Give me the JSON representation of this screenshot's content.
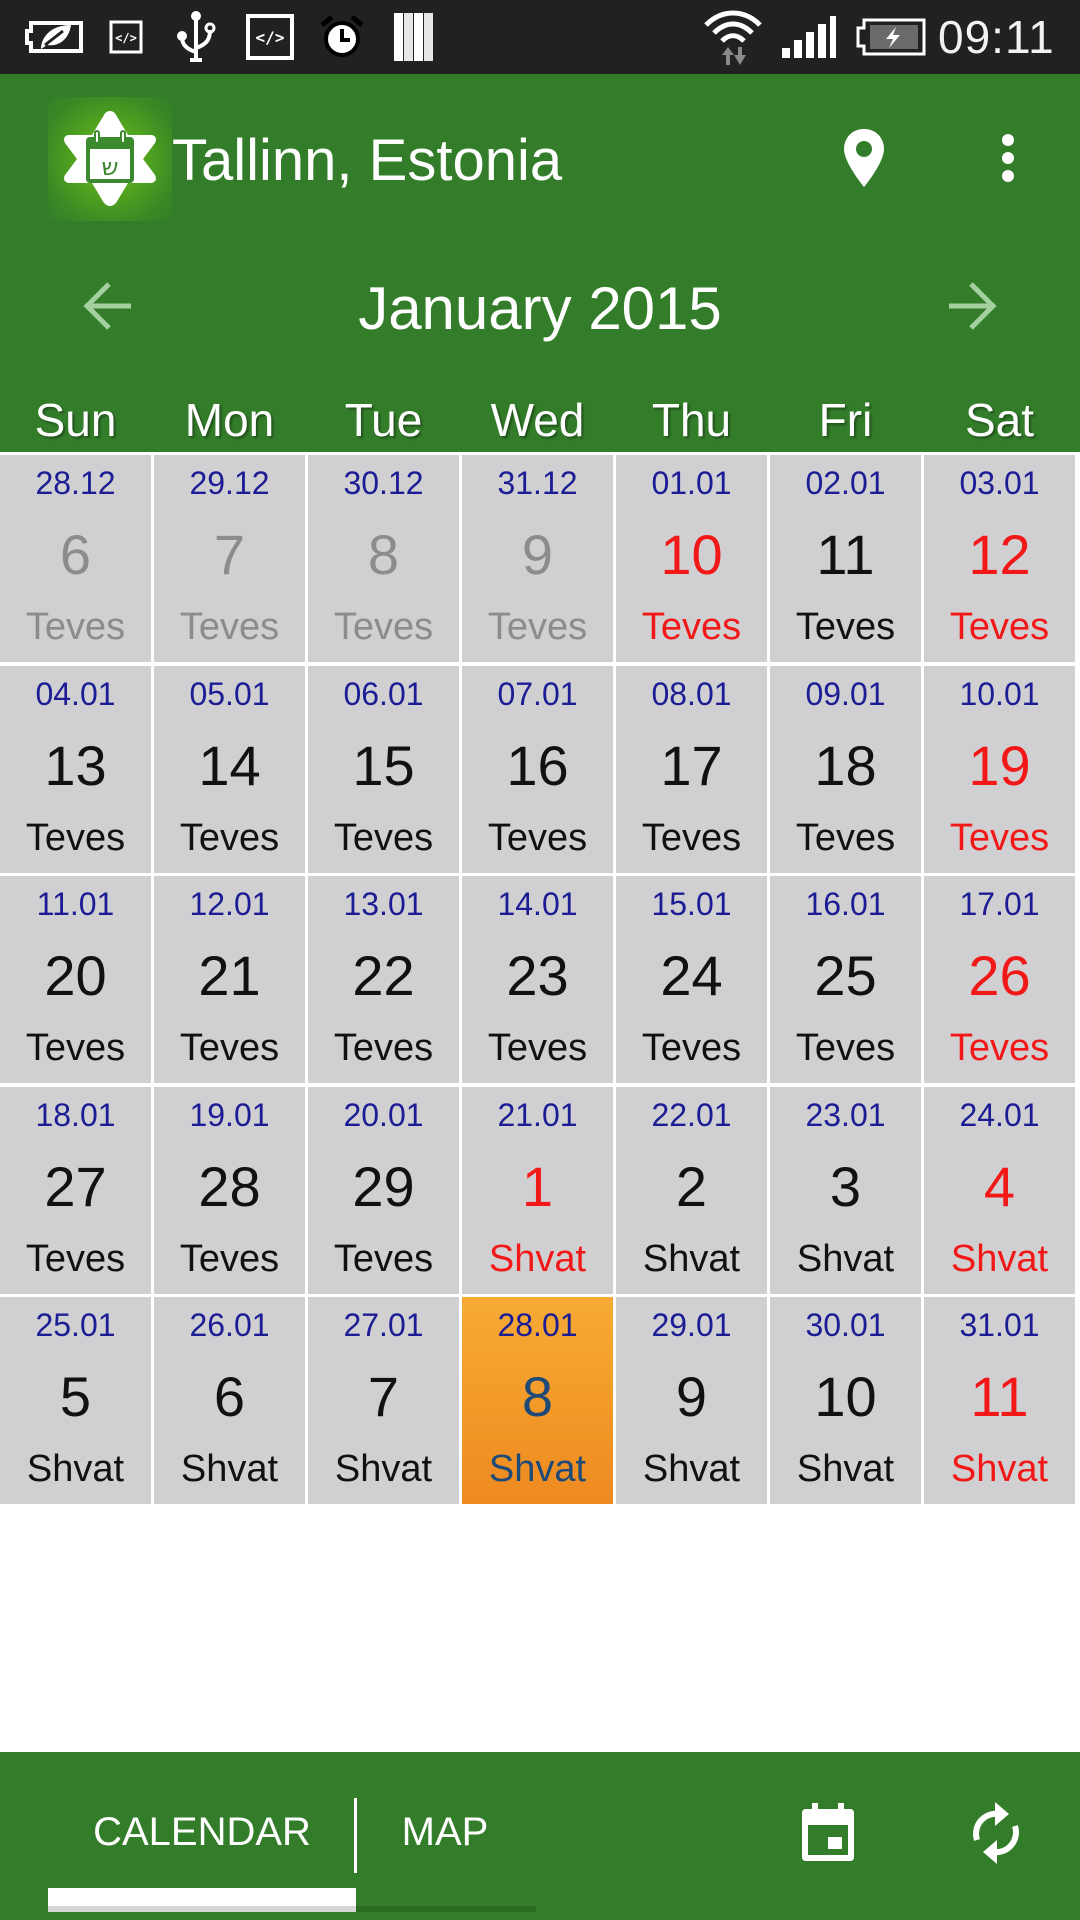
{
  "status_bar": {
    "time": "09:11",
    "left_icons": [
      "battery-saver-icon",
      "developer-code-small-icon",
      "usb-icon",
      "developer-code-icon",
      "alarm-icon",
      "storage-bars-icon"
    ],
    "right_icons": [
      "wifi-data-icon",
      "signal-icon",
      "battery-charging-icon"
    ]
  },
  "app_bar": {
    "logo_glyph": "ש",
    "title": "Tallinn, Estonia",
    "location_icon": "map-pin-icon",
    "menu_icon": "more-vert-icon"
  },
  "calendar": {
    "month_title": "January 2015",
    "prev_label": "previous month",
    "next_label": "next month",
    "weekdays": [
      "Sun",
      "Mon",
      "Tue",
      "Wed",
      "Thu",
      "Fri",
      "Sat"
    ],
    "colors": {
      "gregorian": "#1c1c94",
      "normal": "#111111",
      "other_month": "#8c8c8c",
      "holiday": "#f21818",
      "today_text": "#1f4a78",
      "today_bg": "#f29a2a",
      "cell_bg": "#d0d0d2",
      "brand_green": "#337d2a"
    },
    "weeks": [
      [
        {
          "greg": "28.12",
          "day": "6",
          "month": "Teves",
          "state": "other"
        },
        {
          "greg": "29.12",
          "day": "7",
          "month": "Teves",
          "state": "other"
        },
        {
          "greg": "30.12",
          "day": "8",
          "month": "Teves",
          "state": "other"
        },
        {
          "greg": "31.12",
          "day": "9",
          "month": "Teves",
          "state": "other"
        },
        {
          "greg": "01.01",
          "day": "10",
          "month": "Teves",
          "state": "holiday"
        },
        {
          "greg": "02.01",
          "day": "11",
          "month": "Teves",
          "state": "normal"
        },
        {
          "greg": "03.01",
          "day": "12",
          "month": "Teves",
          "state": "holiday"
        }
      ],
      [
        {
          "greg": "04.01",
          "day": "13",
          "month": "Teves",
          "state": "normal"
        },
        {
          "greg": "05.01",
          "day": "14",
          "month": "Teves",
          "state": "normal"
        },
        {
          "greg": "06.01",
          "day": "15",
          "month": "Teves",
          "state": "normal"
        },
        {
          "greg": "07.01",
          "day": "16",
          "month": "Teves",
          "state": "normal"
        },
        {
          "greg": "08.01",
          "day": "17",
          "month": "Teves",
          "state": "normal"
        },
        {
          "greg": "09.01",
          "day": "18",
          "month": "Teves",
          "state": "normal"
        },
        {
          "greg": "10.01",
          "day": "19",
          "month": "Teves",
          "state": "holiday"
        }
      ],
      [
        {
          "greg": "11.01",
          "day": "20",
          "month": "Teves",
          "state": "normal"
        },
        {
          "greg": "12.01",
          "day": "21",
          "month": "Teves",
          "state": "normal"
        },
        {
          "greg": "13.01",
          "day": "22",
          "month": "Teves",
          "state": "normal"
        },
        {
          "greg": "14.01",
          "day": "23",
          "month": "Teves",
          "state": "normal"
        },
        {
          "greg": "15.01",
          "day": "24",
          "month": "Teves",
          "state": "normal"
        },
        {
          "greg": "16.01",
          "day": "25",
          "month": "Teves",
          "state": "normal"
        },
        {
          "greg": "17.01",
          "day": "26",
          "month": "Teves",
          "state": "holiday"
        }
      ],
      [
        {
          "greg": "18.01",
          "day": "27",
          "month": "Teves",
          "state": "normal"
        },
        {
          "greg": "19.01",
          "day": "28",
          "month": "Teves",
          "state": "normal"
        },
        {
          "greg": "20.01",
          "day": "29",
          "month": "Teves",
          "state": "normal"
        },
        {
          "greg": "21.01",
          "day": "1",
          "month": "Shvat",
          "state": "holiday"
        },
        {
          "greg": "22.01",
          "day": "2",
          "month": "Shvat",
          "state": "normal"
        },
        {
          "greg": "23.01",
          "day": "3",
          "month": "Shvat",
          "state": "normal"
        },
        {
          "greg": "24.01",
          "day": "4",
          "month": "Shvat",
          "state": "holiday"
        }
      ],
      [
        {
          "greg": "25.01",
          "day": "5",
          "month": "Shvat",
          "state": "normal"
        },
        {
          "greg": "26.01",
          "day": "6",
          "month": "Shvat",
          "state": "normal"
        },
        {
          "greg": "27.01",
          "day": "7",
          "month": "Shvat",
          "state": "normal"
        },
        {
          "greg": "28.01",
          "day": "8",
          "month": "Shvat",
          "state": "today"
        },
        {
          "greg": "29.01",
          "day": "9",
          "month": "Shvat",
          "state": "normal"
        },
        {
          "greg": "30.01",
          "day": "10",
          "month": "Shvat",
          "state": "normal"
        },
        {
          "greg": "31.01",
          "day": "11",
          "month": "Shvat",
          "state": "holiday"
        }
      ]
    ]
  },
  "bottom_bar": {
    "tabs": [
      {
        "label": "CALENDAR",
        "active": true
      },
      {
        "label": "MAP",
        "active": false
      }
    ],
    "today_icon": "calendar-today-icon",
    "refresh_icon": "refresh-icon"
  }
}
